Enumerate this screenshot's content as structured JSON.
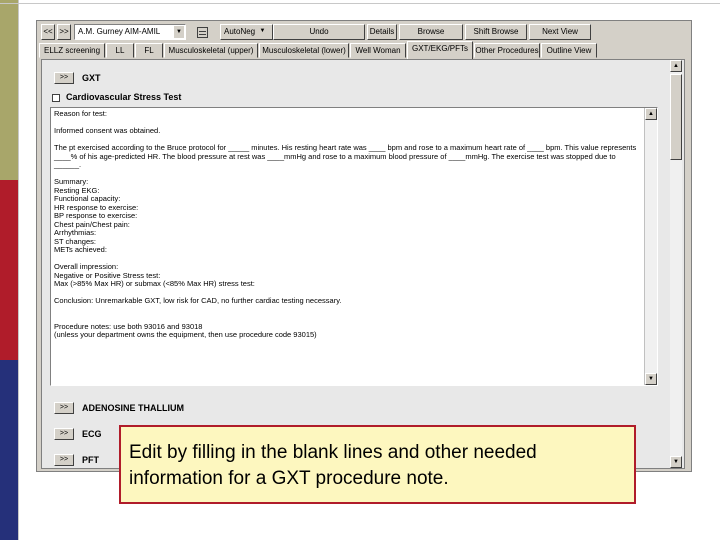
{
  "colors": {
    "olive": "#a8a66a",
    "red": "#b01c2a",
    "navy": "#25307a",
    "callout_bg": "#fdf7bf",
    "callout_border": "#b01c2a"
  },
  "toolbar": {
    "back_icon": "left-arrow-icon",
    "forward_icon": "right-arrow-icon",
    "template_select": "A.M. Gurney AIM-AMIL",
    "note_icon": "note-icon",
    "autonag": "AutoNeg",
    "undo": "Undo",
    "details": "Details",
    "browse": "Browse",
    "shift_browse": "Shift Browse",
    "next_view": "Next View"
  },
  "tabs": [
    "ELLZ screening",
    "LL",
    "FL",
    "Musculoskeletal (upper)",
    "Musculoskeletal (lower)",
    "Well Woman",
    "GXT/EKG/PFTs",
    "Other Procedures",
    "Outline View"
  ],
  "active_tab": 6,
  "gxt": {
    "button": ">>",
    "label": "GXT"
  },
  "stress": {
    "label": "Cardiovascular Stress Test"
  },
  "note_text": "Reason for test:\n\nInformed consent was obtained.\n\nThe pt exercised according to the Bruce protocol for _____ minutes. His resting heart rate was ____ bpm and rose to a maximum heart rate of ____ bpm. This value represents ____% of his age-predicted HR. The blood pressure at rest was ____mmHg and rose to a maximum blood pressure of ____mmHg. The exercise test was stopped due to ______.\n\nSummary:\nResting EKG:\nFunctional capacity:\nHR response to exercise:\nBP response to exercise:\nChest pain/Chest pain:\nArrhythmias:\nST changes:\nMETs achieved:\n\nOverall impression:\nNegative or Positive Stress test:\nMax (>85% Max HR) or submax (<85% Max HR) stress test:\n\nConclusion: Unremarkable GXT, low risk for CAD, no further cardiac testing necessary.\n\n\nProcedure notes: use both 93016 and 93018\n(unless your department owns the equipment, then use procedure code 93015)",
  "sections": [
    {
      "button": ">>",
      "label": "ADENOSINE THALLIUM"
    },
    {
      "button": ">>",
      "label": "ECG"
    },
    {
      "button": ">>",
      "label": "PFT"
    }
  ],
  "scroll": {
    "up_icon": "scroll-up-icon",
    "down_icon": "scroll-down-icon"
  },
  "callout": "Edit by filling in the blank lines and other needed information for a GXT procedure note."
}
